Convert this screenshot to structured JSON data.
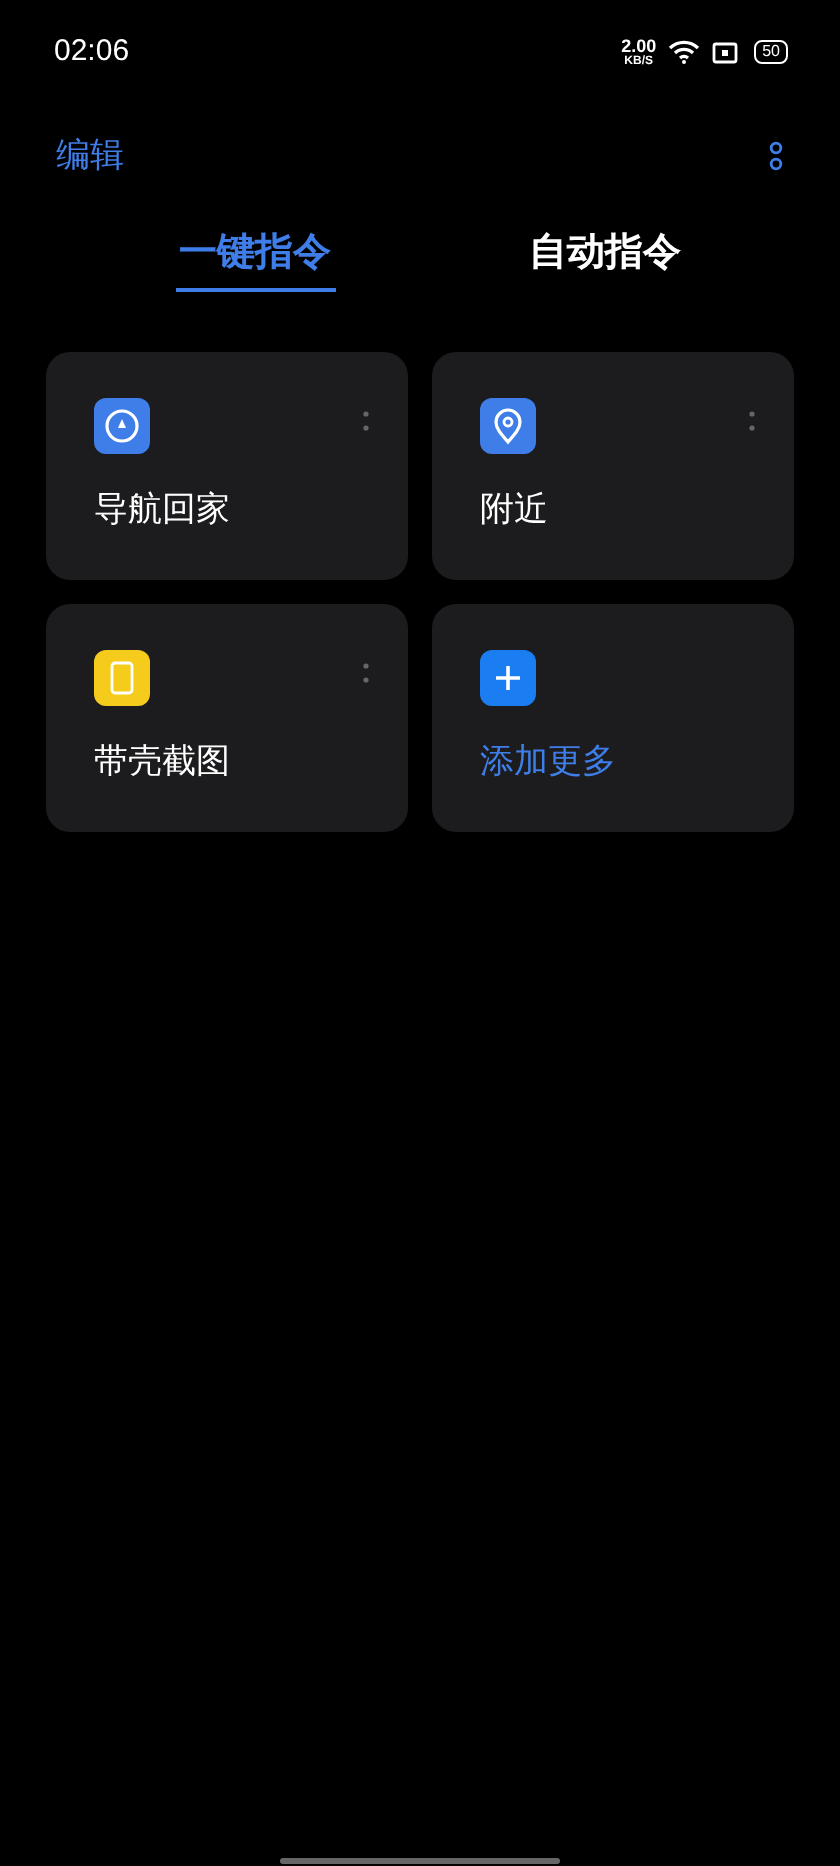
{
  "status_bar": {
    "time": "02:06",
    "speed": "2.00",
    "speed_unit": "KB/S",
    "battery": "50"
  },
  "header": {
    "edit": "编辑"
  },
  "tabs": [
    {
      "label": "一键指令",
      "selected": true
    },
    {
      "label": "自动指令",
      "selected": false
    }
  ],
  "cards": [
    {
      "kind": "shortcut",
      "label": "导航回家"
    },
    {
      "kind": "shortcut",
      "label": "附近"
    },
    {
      "kind": "shortcut",
      "label": "带壳截图"
    },
    {
      "kind": "add",
      "label": "添加更多"
    }
  ]
}
